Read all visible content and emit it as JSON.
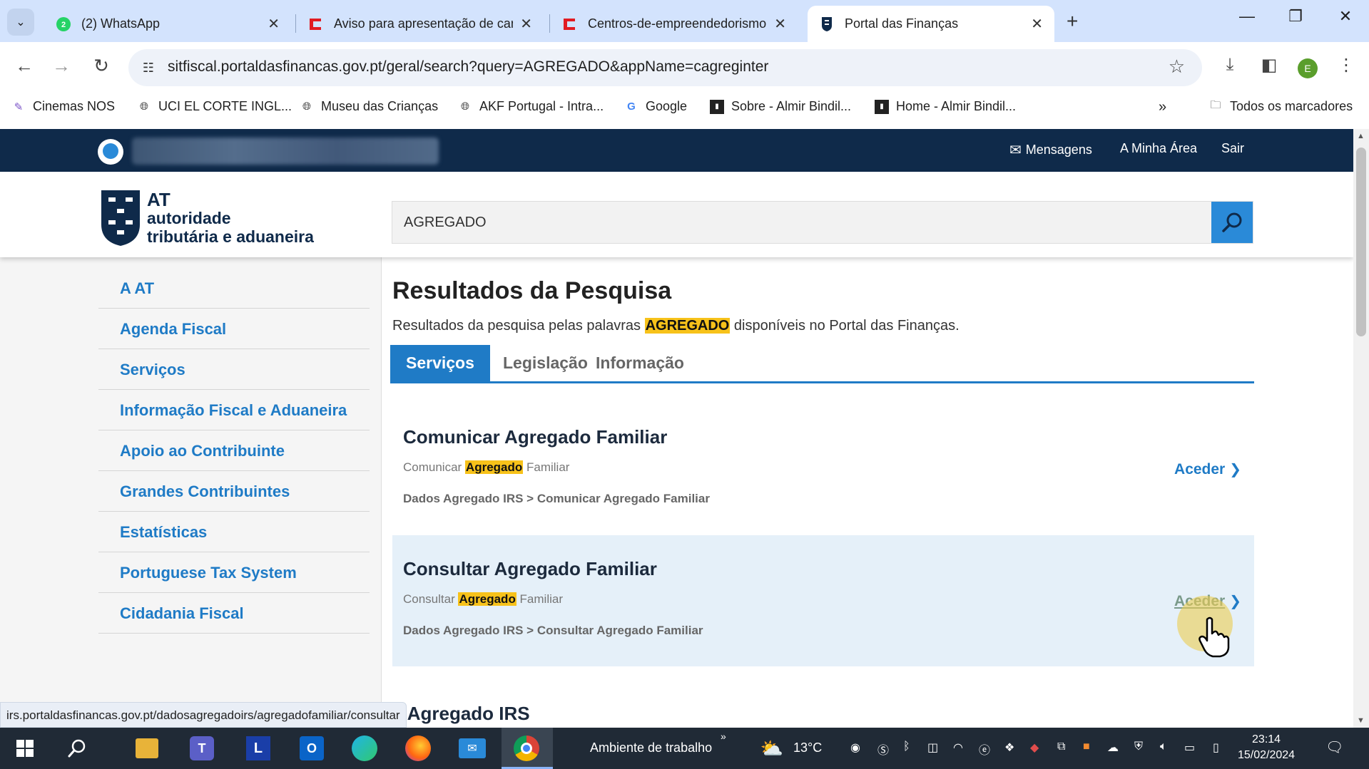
{
  "browser": {
    "tabs": [
      {
        "title": "(2) WhatsApp",
        "icon": "whatsapp-icon"
      },
      {
        "title": "Aviso para apresentação de can",
        "icon": "red-e-icon"
      },
      {
        "title": "Centros-de-empreendedorismo",
        "icon": "red-e-icon"
      },
      {
        "title": "Portal das Finanças",
        "icon": "at-shield-icon",
        "active": true
      }
    ],
    "url": "sitfiscal.portaldasfinancas.gov.pt/geral/search?query=AGREGADO&appName=cagreginter",
    "profile_initial": "E",
    "bookmarks": [
      "Cinemas NOS",
      "UCI EL CORTE INGL...",
      "Museu das Crianças",
      "AKF Portugal - Intra...",
      "Google",
      "Sobre - Almir Bindil...",
      "Home - Almir Bindil..."
    ],
    "all_bookmarks": "Todos os marcadores"
  },
  "portal": {
    "top_links": {
      "messages": "Mensagens",
      "my_area": "A Minha Área",
      "logout": "Sair"
    },
    "logo": {
      "line1": "AT",
      "line2": "autoridade",
      "line3": "tributária e aduaneira"
    },
    "search_value": "AGREGADO",
    "sidebar": [
      "A AT",
      "Agenda Fiscal",
      "Serviços",
      "Informação Fiscal e Aduaneira",
      "Apoio ao Contribuinte",
      "Grandes Contribuintes",
      "Estatísticas",
      "Portuguese Tax System",
      "Cidadania Fiscal"
    ],
    "results_title": "Resultados da Pesquisa",
    "results_sub_before": "Resultados da pesquisa pelas palavras ",
    "results_sub_keyword": "AGREGADO",
    "results_sub_after": " disponíveis no Portal das Finanças.",
    "tabs": [
      "Serviços",
      "Legislação",
      "Informação"
    ],
    "results": [
      {
        "title": "Comunicar Agregado Familiar",
        "desc_before": "Comunicar ",
        "desc_keyword": "Agregado",
        "desc_after": " Familiar",
        "path": "Dados Agregado IRS > Comunicar Agregado Familiar",
        "action": "Aceder"
      },
      {
        "title": "Consultar Agregado Familiar",
        "desc_before": "Consultar ",
        "desc_keyword": "Agregado",
        "desc_after": " Familiar",
        "path": "Dados Agregado IRS > Consultar Agregado Familiar",
        "action": "Aceder"
      }
    ],
    "next_result_partial": "s Agregado IRS"
  },
  "status_url": "irs.portaldasfinancas.gov.pt/dadosagregadoirs/agregadofamiliar/consultar",
  "taskbar": {
    "search_text": "Ambiente de trabalho",
    "temperature": "13°C",
    "time": "23:14",
    "date": "15/02/2024"
  },
  "colors": {
    "portal_navy": "#0f2a4a",
    "portal_blue": "#1f7bc6",
    "highlight": "#f7c21a",
    "tabstrip": "#d3e3fd"
  }
}
